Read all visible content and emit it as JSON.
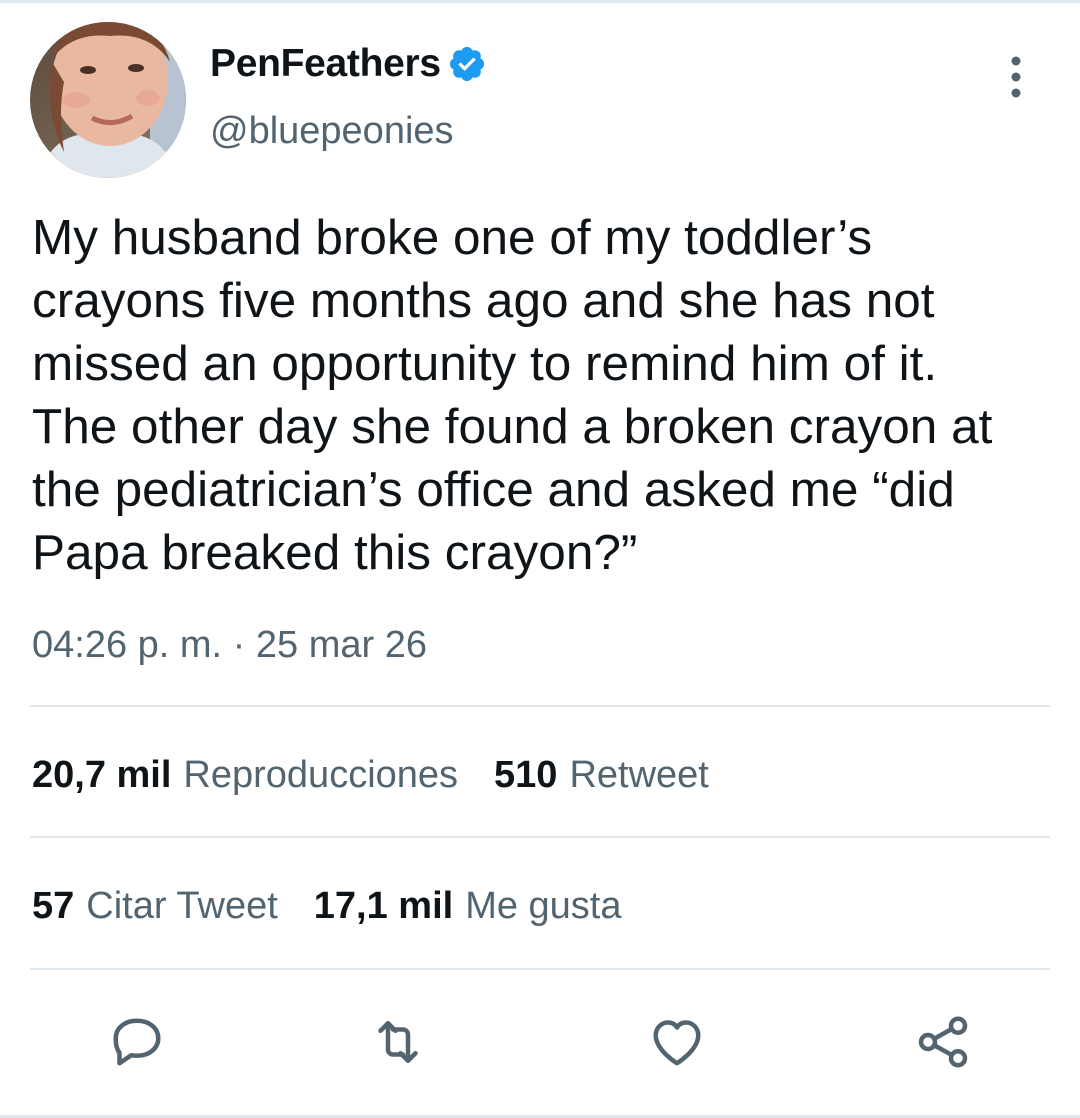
{
  "tweet": {
    "display_name": "PenFeathers",
    "handle": "@bluepeonies",
    "text": "My husband broke one of my toddler’s\ncrayons five months ago and she has not\nmissed an opportunity to remind him of it.\nThe other day she found a broken crayon at\nthe pediatrician’s office and asked me “did\nPapa breaked this crayon?”",
    "timestamp": "04:26 p. m. · 25 mar 26"
  },
  "stats": {
    "views": {
      "count": "20,7 mil",
      "label": "Reproducciones"
    },
    "retweets": {
      "count": "510",
      "label": "Retweet"
    },
    "quotes": {
      "count": "57",
      "label": "Citar Tweet"
    },
    "likes": {
      "count": "17,1 mil",
      "label": "Me gusta"
    }
  },
  "icons": {
    "verified": "verified-badge-icon",
    "more": "more-vertical-icon",
    "reply": "reply-icon",
    "retweet": "retweet-icon",
    "like": "heart-icon",
    "share": "share-icon"
  },
  "colors": {
    "text": "#0f1419",
    "secondary": "#536471",
    "verified": "#1d9bf0",
    "divider": "#e1e8ed"
  }
}
